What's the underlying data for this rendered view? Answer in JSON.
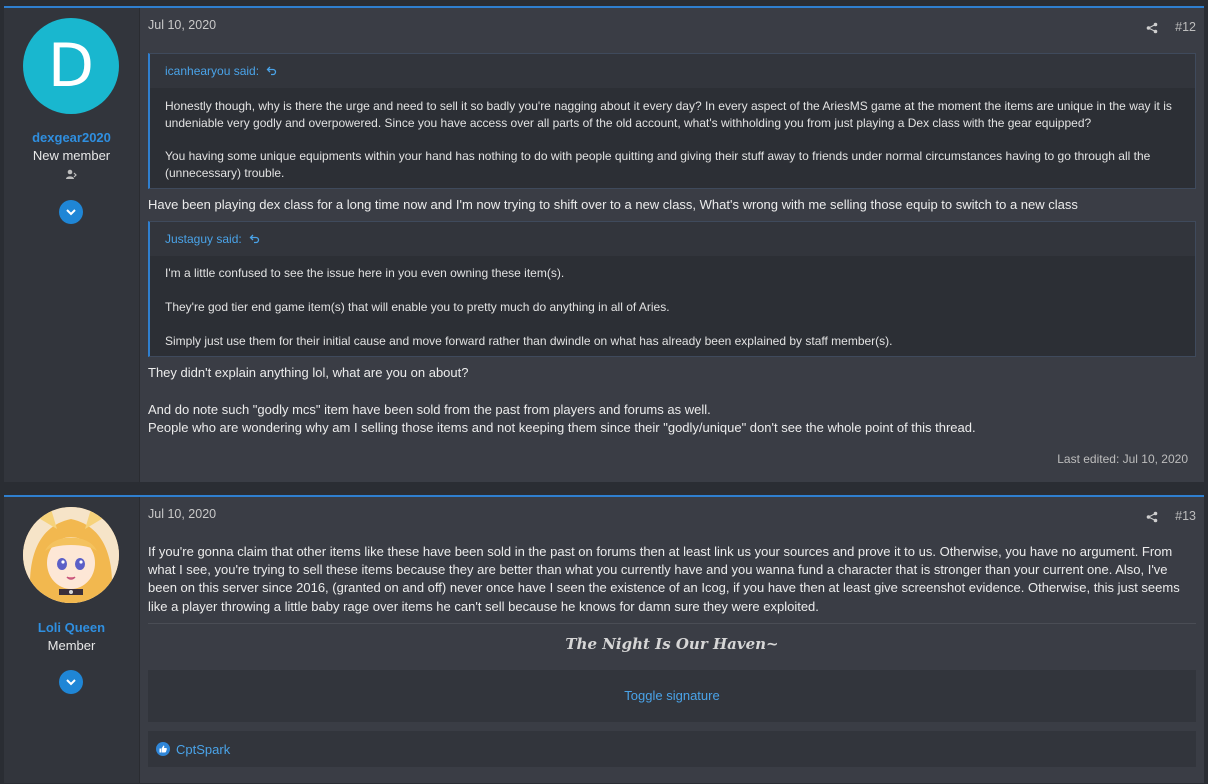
{
  "posts": [
    {
      "avatar_letter": "D",
      "username": "dexgear2020",
      "user_title": "New member",
      "date": "Jul 10, 2020",
      "post_number": "#12",
      "quote1": {
        "author": "icanhearyou said:",
        "lines": [
          "Honestly though, why is there the urge and need to sell it so badly you're nagging about it every day? In every aspect of the AriesMS game at the moment the items are unique in the way it is",
          "undeniable very godly and overpowered. Since you have access over all parts of the old account, what's withholding you from just playing a Dex class with the gear equipped?",
          "You having some unique equipments within your hand has nothing to do with people quitting and giving their stuff away to friends under normal circumstances having to go through all the",
          "(unnecessary) trouble."
        ]
      },
      "reply1": "Have been playing dex class for a long time now and I'm now trying to shift over to a new class, What's wrong with me selling those equip to switch to a new class",
      "quote2": {
        "author": "Justaguy said:",
        "lines": [
          "I'm a little confused to see the issue here in you even owning these item(s).",
          "They're god tier end game item(s) that will enable you to pretty much do anything in all of Aries.",
          "Simply just use them for their initial cause and move forward rather than dwindle on what has already been explained by staff member(s)."
        ]
      },
      "reply2": [
        "They didn't explain anything lol, what are you on about?",
        "And do note such \"godly mcs\" item have been sold from the past from players and forums as well.",
        "People who are wondering why am I selling those items and not keeping them since their \"godly/unique\" don't see the whole point of this thread."
      ],
      "last_edited": "Last edited: Jul 10, 2020"
    },
    {
      "username": "Loli Queen",
      "user_title": "Member",
      "date": "Jul 10, 2020",
      "post_number": "#13",
      "body": [
        "If you're gonna claim that other items like these have been sold in the past on forums then at least link us your sources and prove it to us. Otherwise, you have no argument. From",
        "what I see, you're trying to sell these items because they are better than what you currently have and you wanna fund a character that is stronger than your current one. Also, I've",
        "been on this server since 2016, (granted on and off) never once have I seen the existence of an Icog, if you have then at least give screenshot evidence. Otherwise, this just seems",
        "like a player throwing a little baby rage over items he can't sell because he knows for damn sure they were exploited."
      ],
      "signature": "The Night Is Our Haven~",
      "toggle_signature": "Toggle signature",
      "reaction_user": "CptSpark"
    }
  ],
  "icons": {
    "share": "share-icon",
    "reply_arrow": "quote-jump-icon",
    "expand": "chevron-down-icon",
    "user": "user-icon",
    "like": "like-icon"
  },
  "colors": {
    "accent": "#2f7fcf",
    "link": "#4aa3e8",
    "avatar_bg": "#19b7cf"
  }
}
